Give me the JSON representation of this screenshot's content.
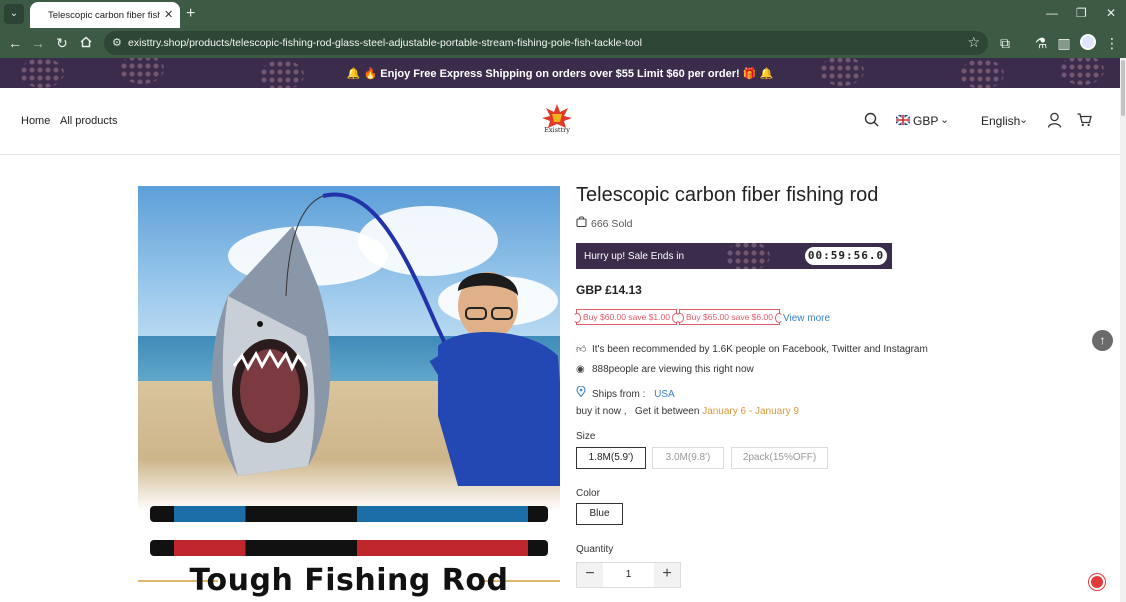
{
  "browser": {
    "tab_title": "Telescopic carbon fiber fishing",
    "url": "existtry.shop/products/telescopic-fishing-rod-glass-steel-adjustable-portable-stream-fishing-pole-fish-tackle-tool",
    "icons": [
      "tab-list-icon",
      "close-icon",
      "plus-icon",
      "back-icon",
      "forward-icon",
      "reload-icon",
      "home-icon",
      "site-info-icon",
      "star-icon",
      "extensions-icon",
      "labs-icon",
      "side-panel-icon",
      "profile-icon",
      "menu-icon",
      "minimize-icon",
      "restore-icon",
      "close-window-icon"
    ]
  },
  "announcement": {
    "text": "🔔 🔥 Enjoy Free Express Shipping on orders over $55 Limit $60 per order! 🎁 🔔"
  },
  "header": {
    "nav": [
      "Home",
      "All products"
    ],
    "logo_text": "Existtry",
    "currency": "GBP",
    "language": "English"
  },
  "product": {
    "image_tagline": "Tough Fishing Rod",
    "title": "Telescopic carbon fiber fishing rod",
    "sold": "666 Sold",
    "sale_label": "Hurry up! Sale Ends in",
    "countdown": "00:59:56.0",
    "price": "GBP £14.13",
    "promos": [
      "Buy $60.00 save $1.00",
      "Buy $65.00 save $6.00"
    ],
    "view_more": "View more",
    "recommended": "It's been recommended by 1.6K people on Facebook, Twitter and Instagram",
    "viewing": "888people are viewing this right now",
    "ships_label": "Ships from :",
    "ships_from": "USA",
    "delivery_prefix": "buy it now ,   Get it between",
    "delivery_range": "January 6 - January 9",
    "size_label": "Size",
    "sizes": [
      "1.8M(5.9')",
      "3.0M(9.8')",
      "2pack(15%OFF)"
    ],
    "color_label": "Color",
    "colors": [
      "Blue"
    ],
    "quantity_label": "Quantity",
    "quantity": "1",
    "minus": "−",
    "plus": "+"
  },
  "colors": {
    "browser_chrome": "#3c5a44",
    "announcement_bg": "#3a2c4a",
    "promo": "#e35b6a",
    "link": "#3b82c6",
    "date_highlight": "#d99a3b"
  }
}
